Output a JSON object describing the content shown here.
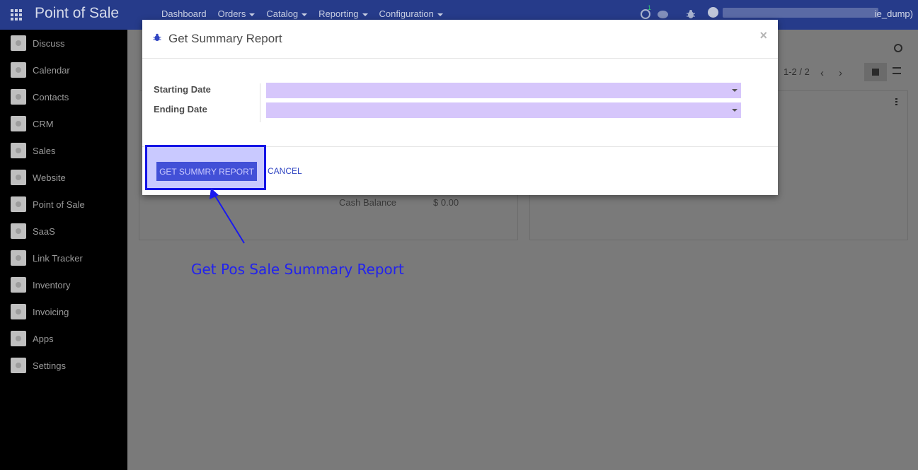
{
  "navbar": {
    "brand": "Point of Sale",
    "menu": [
      {
        "label": "Dashboard",
        "dropdown": false
      },
      {
        "label": "Orders",
        "dropdown": true
      },
      {
        "label": "Catalog",
        "dropdown": true
      },
      {
        "label": "Reporting",
        "dropdown": true
      },
      {
        "label": "Configuration",
        "dropdown": true
      }
    ],
    "activity_count": "1",
    "db_name": "ie_dump)"
  },
  "sidebar": {
    "items": [
      {
        "label": "Discuss"
      },
      {
        "label": "Calendar"
      },
      {
        "label": "Contacts"
      },
      {
        "label": "CRM"
      },
      {
        "label": "Sales"
      },
      {
        "label": "Website"
      },
      {
        "label": "Point of Sale"
      },
      {
        "label": "SaaS"
      },
      {
        "label": "Link Tracker"
      },
      {
        "label": "Inventory"
      },
      {
        "label": "Invoicing"
      },
      {
        "label": "Apps"
      },
      {
        "label": "Settings"
      }
    ]
  },
  "content": {
    "pager": "1-2 / 2",
    "card": {
      "cash_label": "Cash Balance",
      "cash_value": "$ 0.00"
    }
  },
  "modal": {
    "title": "Get Summary Report",
    "fields": {
      "starting_date": {
        "label": "Starting Date",
        "value": ""
      },
      "ending_date": {
        "label": "Ending Date",
        "value": ""
      }
    },
    "primary_button": "GET SUMMRY REPORT",
    "cancel_button": "CANCEL",
    "close_symbol": "×"
  },
  "annotation": {
    "text": "Get Pos Sale Summary Report",
    "color": "#2222ee"
  },
  "colors": {
    "navbar": "#263b8a",
    "primary": "#3045c2",
    "date_input_bg": "#d6c6fb"
  }
}
